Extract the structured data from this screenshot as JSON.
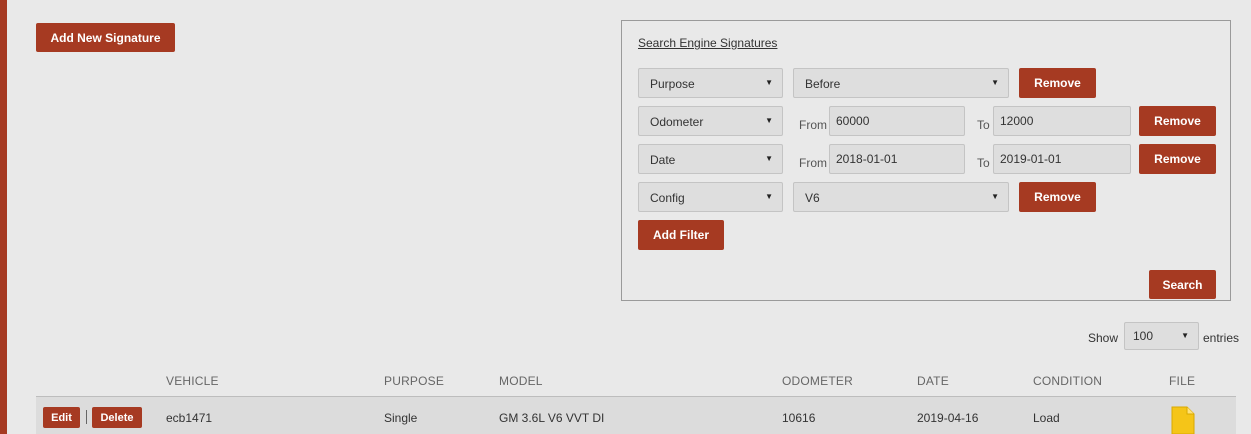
{
  "header": {
    "add_label": "Add New Signature"
  },
  "search_panel": {
    "title": "Search Engine Signatures",
    "filters": [
      {
        "field": "Purpose",
        "value": "Before",
        "remove_label": "Remove"
      },
      {
        "field": "Odometer",
        "from_label": "From",
        "from_value": "60000",
        "to_label": "To",
        "to_value": "12000",
        "remove_label": "Remove"
      },
      {
        "field": "Date",
        "from_label": "From",
        "from_value": "2018-01-01",
        "to_label": "To",
        "to_value": "2019-01-01",
        "remove_label": "Remove"
      },
      {
        "field": "Config",
        "value": "V6",
        "remove_label": "Remove"
      }
    ],
    "add_filter_label": "Add Filter",
    "search_label": "Search"
  },
  "table": {
    "show_label": "Show",
    "page_size": "100",
    "entries_label": "entries",
    "columns": [
      "VEHICLE",
      "PURPOSE",
      "MODEL",
      "ODOMETER",
      "DATE",
      "CONDITION",
      "FILE"
    ],
    "rows": [
      {
        "edit_label": "Edit",
        "delete_label": "Delete",
        "vehicle": "ecb1471",
        "purpose": "Single",
        "model": "GM 3.6L V6 VVT DI",
        "odometer": "10616",
        "date": "2019-04-16",
        "condition": "Load",
        "file_icon": "file-icon"
      }
    ]
  },
  "colors": {
    "accent": "#a63a22",
    "background": "#e9e9e9",
    "file_icon": "#f5c518"
  }
}
